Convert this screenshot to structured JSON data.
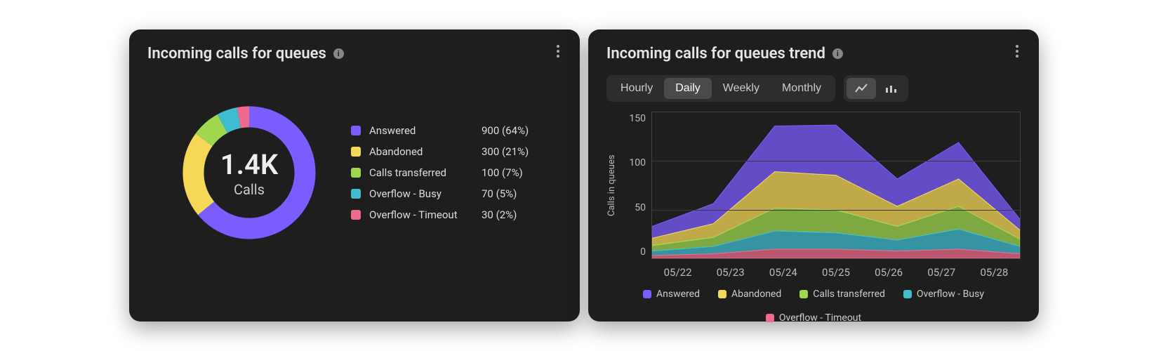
{
  "colors": {
    "answered": "#7b5cff",
    "abandoned": "#f5d858",
    "transferred": "#9fd84f",
    "busy": "#3fbccf",
    "timeout": "#ef6a8b"
  },
  "left_card": {
    "title": "Incoming calls for queues",
    "center_value": "1.4K",
    "center_label": "Calls",
    "legend": [
      {
        "label": "Answered",
        "value": "900 (64%)",
        "color_key": "answered"
      },
      {
        "label": "Abandoned",
        "value": "300 (21%)",
        "color_key": "abandoned"
      },
      {
        "label": "Calls transferred",
        "value": "100 (7%)",
        "color_key": "transferred"
      },
      {
        "label": "Overflow - Busy",
        "value": "70 (5%)",
        "color_key": "busy"
      },
      {
        "label": "Overflow - Timeout",
        "value": "30 (2%)",
        "color_key": "timeout"
      }
    ]
  },
  "right_card": {
    "title": "Incoming calls for queues trend",
    "intervals": [
      "Hourly",
      "Daily",
      "Weekly",
      "Monthly"
    ],
    "active_interval": "Daily",
    "ylabel": "Calls in queues",
    "yticks": [
      "150",
      "100",
      "50",
      "0"
    ],
    "xticks": [
      "05/22",
      "05/23",
      "05/24",
      "05/25",
      "05/26",
      "05/27",
      "05/28"
    ],
    "legend": [
      {
        "label": "Answered",
        "color_key": "answered"
      },
      {
        "label": "Abandoned",
        "color_key": "abandoned"
      },
      {
        "label": "Calls transferred",
        "color_key": "transferred"
      },
      {
        "label": "Overflow - Busy",
        "color_key": "busy"
      },
      {
        "label": "Overflow - Timeout",
        "color_key": "timeout"
      }
    ]
  },
  "chart_data": [
    {
      "type": "pie",
      "title": "Incoming calls for queues",
      "total_label": "1.4K Calls",
      "series": [
        {
          "name": "Answered",
          "value": 900,
          "pct": 64
        },
        {
          "name": "Abandoned",
          "value": 300,
          "pct": 21
        },
        {
          "name": "Calls transferred",
          "value": 100,
          "pct": 7
        },
        {
          "name": "Overflow - Busy",
          "value": 70,
          "pct": 5
        },
        {
          "name": "Overflow - Timeout",
          "value": 30,
          "pct": 2
        }
      ]
    },
    {
      "type": "area",
      "title": "Incoming calls for queues trend",
      "xlabel": "",
      "ylabel": "Calls in queues",
      "stacked": true,
      "ylim": [
        0,
        160
      ],
      "x": [
        "05/22",
        "05/23",
        "05/24",
        "05/25",
        "05/26",
        "05/27",
        "05/28"
      ],
      "series": [
        {
          "name": "Overflow - Timeout",
          "values": [
            3,
            5,
            10,
            10,
            8,
            10,
            5
          ]
        },
        {
          "name": "Overflow - Busy",
          "values": [
            5,
            8,
            20,
            18,
            12,
            22,
            8
          ]
        },
        {
          "name": "Calls transferred",
          "values": [
            6,
            10,
            25,
            25,
            15,
            25,
            8
          ]
        },
        {
          "name": "Abandoned",
          "values": [
            8,
            15,
            40,
            38,
            22,
            30,
            10
          ]
        },
        {
          "name": "Answered",
          "values": [
            13,
            22,
            50,
            55,
            30,
            40,
            12
          ]
        }
      ],
      "stacked_totals": [
        35,
        60,
        145,
        146,
        87,
        127,
        43
      ]
    }
  ]
}
